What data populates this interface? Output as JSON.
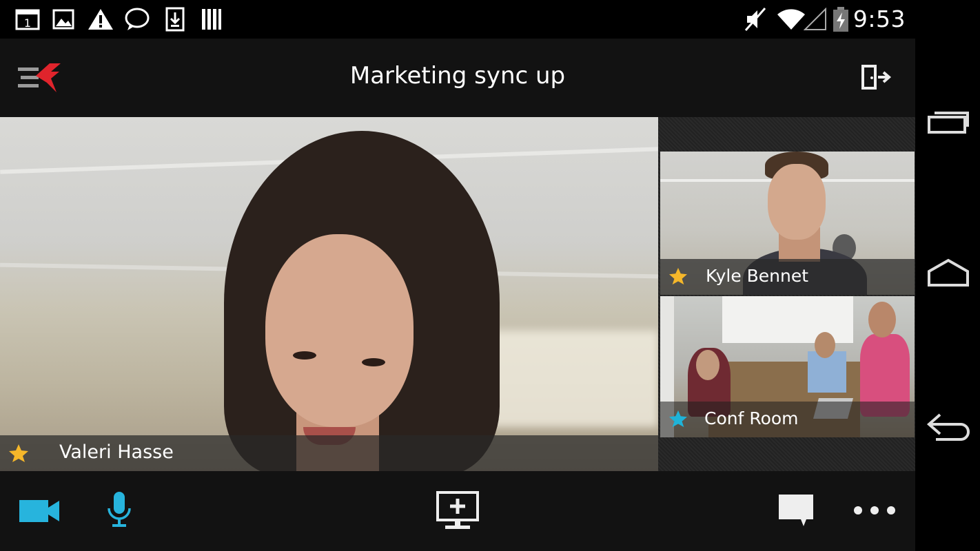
{
  "status_bar": {
    "time": "9:53",
    "left_icons": [
      "calendar-icon",
      "image-icon",
      "warning-icon",
      "chat-bubble-icon",
      "download-icon",
      "storage-icon"
    ],
    "right_icons": [
      "mute-icon",
      "wifi-icon",
      "signal-icon",
      "battery-charging-icon"
    ],
    "calendar_day": "1"
  },
  "header": {
    "title": "Marketing sync up",
    "logo_icon": "app-logo-icon",
    "exit_icon": "exit-call-icon"
  },
  "main_participant": {
    "name": "Valeri Hasse",
    "star_color": "#f5b72a"
  },
  "participants": [
    {
      "name": "Kyle Bennet",
      "star_color": "#f5b72a"
    },
    {
      "name": "Conf Room",
      "star_color": "#1fb3d8"
    }
  ],
  "toolbar": {
    "camera_icon": "video-camera-icon",
    "mic_icon": "microphone-icon",
    "share_icon": "share-screen-icon",
    "chat_icon": "chat-icon",
    "more_icon": "more-options-icon",
    "accent": "#27b4dd"
  },
  "nav_bar": {
    "recents_icon": "recent-apps-icon",
    "home_icon": "home-icon",
    "back_icon": "back-icon"
  },
  "colors": {
    "header_bg": "#121212",
    "logo_red": "#e0242c"
  }
}
